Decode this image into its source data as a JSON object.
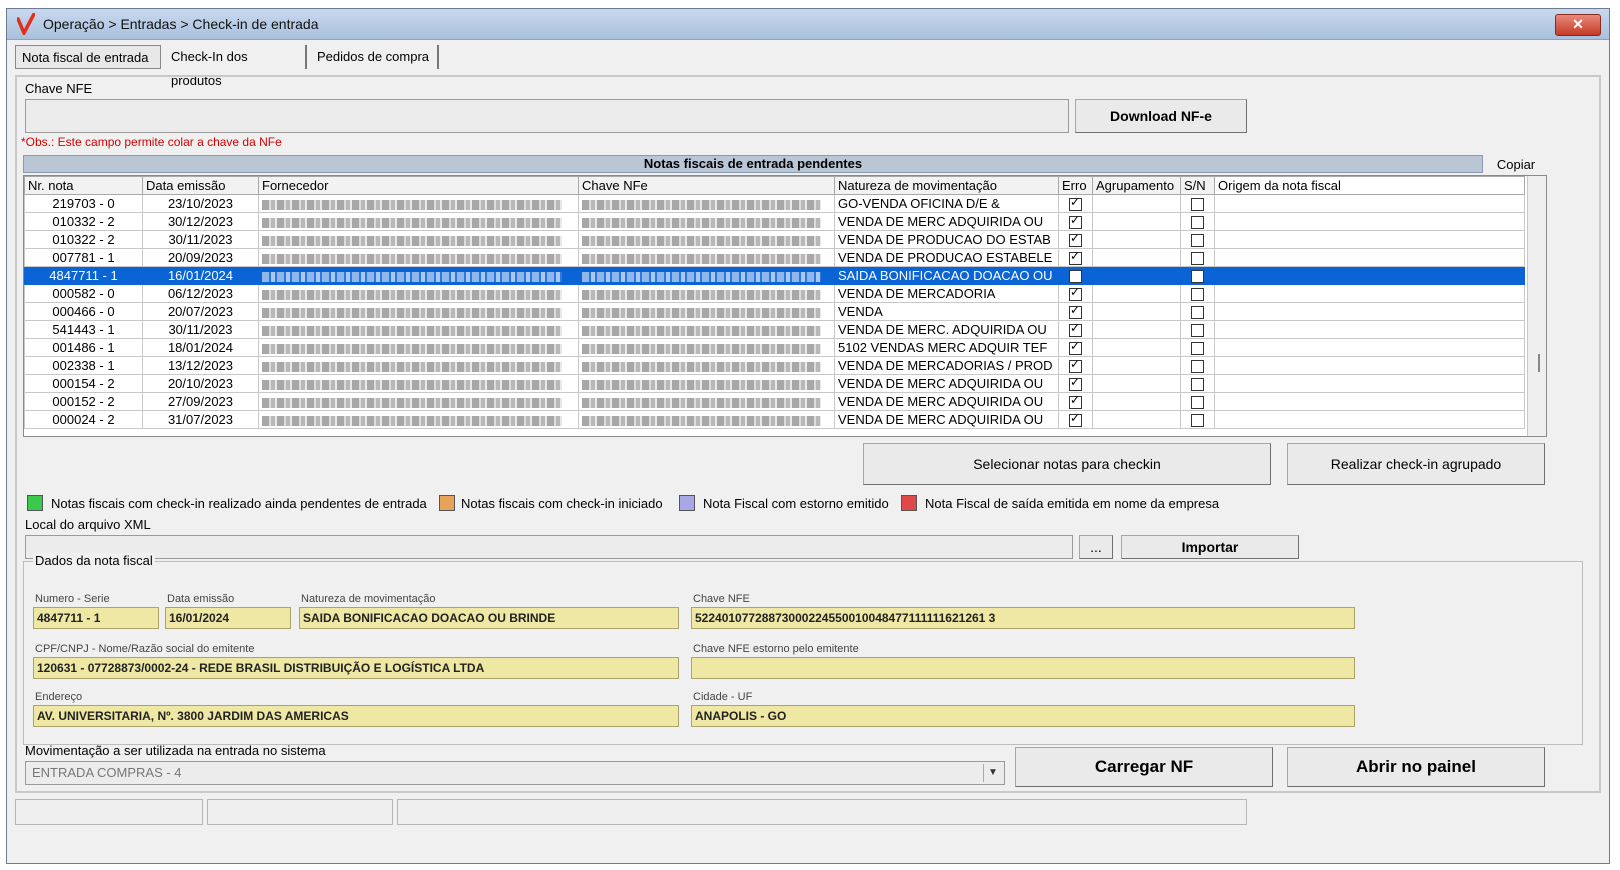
{
  "window": {
    "title": "Operação > Entradas > Check-in de entrada",
    "close_label": "✕"
  },
  "tabs": [
    {
      "label": "Nota fiscal de entrada"
    },
    {
      "label": "Check-In dos produtos"
    },
    {
      "label": "Pedidos de compra"
    }
  ],
  "nfe_key": {
    "label": "Chave NFE",
    "value": "",
    "download_label": "Download NF-e",
    "note": "*Obs.: Este campo permite colar a chave da NFe"
  },
  "grid": {
    "title": "Notas fiscais de entrada pendentes",
    "copy_label": "Copiar",
    "columns": [
      "Nr. nota",
      "Data emissão",
      "Fornecedor",
      "Chave NFe",
      "Natureza de movimentação",
      "Erro",
      "Agrupamento",
      "S/N",
      "Origem da nota fiscal"
    ],
    "rows": [
      {
        "nr": "219703 - 0",
        "date": "23/10/2023",
        "nature": "GO-VENDA OFICINA D/E &",
        "erro": true,
        "sn": false,
        "selected": false
      },
      {
        "nr": "010332 - 2",
        "date": "30/12/2023",
        "nature": "VENDA DE MERC ADQUIRIDA OU",
        "erro": true,
        "sn": false,
        "selected": false
      },
      {
        "nr": "010322 - 2",
        "date": "30/11/2023",
        "nature": "VENDA DE PRODUCAO DO ESTAB",
        "erro": true,
        "sn": false,
        "selected": false
      },
      {
        "nr": "007781 - 1",
        "date": "20/09/2023",
        "nature": "VENDA DE PRODUCAO ESTABELE",
        "erro": true,
        "sn": false,
        "selected": false
      },
      {
        "nr": "4847711 - 1",
        "date": "16/01/2024",
        "nature": "SAIDA BONIFICACAO DOACAO OU",
        "erro": false,
        "sn": false,
        "selected": true
      },
      {
        "nr": "000582 - 0",
        "date": "06/12/2023",
        "nature": "VENDA DE MERCADORIA",
        "erro": true,
        "sn": false,
        "selected": false
      },
      {
        "nr": "000466 - 0",
        "date": "20/07/2023",
        "nature": "VENDA",
        "erro": true,
        "sn": false,
        "selected": false
      },
      {
        "nr": "541443 - 1",
        "date": "30/11/2023",
        "nature": "VENDA DE MERC. ADQUIRIDA OU",
        "erro": true,
        "sn": false,
        "selected": false
      },
      {
        "nr": "001486 - 1",
        "date": "18/01/2024",
        "nature": "5102  VENDAS MERC ADQUIR TEF",
        "erro": true,
        "sn": false,
        "selected": false
      },
      {
        "nr": "002338 - 1",
        "date": "13/12/2023",
        "nature": "VENDA DE MERCADORIAS / PROD",
        "erro": true,
        "sn": false,
        "selected": false
      },
      {
        "nr": "000154 - 2",
        "date": "20/10/2023",
        "nature": "VENDA DE MERC ADQUIRIDA OU",
        "erro": true,
        "sn": false,
        "selected": false
      },
      {
        "nr": "000152 - 2",
        "date": "27/09/2023",
        "nature": "VENDA DE MERC ADQUIRIDA OU",
        "erro": true,
        "sn": false,
        "selected": false
      },
      {
        "nr": "000024 - 2",
        "date": "31/07/2023",
        "nature": "VENDA DE MERC ADQUIRIDA OU",
        "erro": true,
        "sn": false,
        "selected": false
      }
    ]
  },
  "actions": {
    "select_label": "Selecionar notas para checkin",
    "group_label": "Realizar check-in agrupado"
  },
  "legend": [
    {
      "label": "Notas fiscais com check-in realizado ainda pendentes de entrada",
      "color": "#3cc84a"
    },
    {
      "label": "Notas fiscais com check-in iniciado",
      "color": "#e8a35a"
    },
    {
      "label": "Nota Fiscal com estorno emitido",
      "color": "#a8a8e6"
    },
    {
      "label": "Nota Fiscal de saída emitida em nome da empresa",
      "color": "#e04848"
    }
  ],
  "xml": {
    "label": "Local do arquivo XML",
    "value": "",
    "browse_label": "...",
    "import_label": "Importar"
  },
  "invoice": {
    "title": "Dados da nota fiscal",
    "numero_label": "Numero - Serie",
    "numero": "4847711 - 1",
    "data_label": "Data emissão",
    "data": "16/01/2024",
    "natureza_label": "Natureza de movimentação",
    "natureza": "SAIDA BONIFICACAO DOACAO OU BRINDE",
    "chave_label": "Chave NFE",
    "chave": "52240107728873000224550010048477111111621261 3",
    "cnpj_label": "CPF/CNPJ - Nome/Razão social do emitente",
    "cnpj": "120631  -  07728873/0002-24 - REDE BRASIL DISTRIBUIÇÃO E LOGÍSTICA LTDA",
    "estorno_label": "Chave NFE estorno pelo emitente",
    "estorno": "",
    "endereco_label": "Endereço",
    "endereco": "AV. UNIVERSITARIA, Nº. 3800 JARDIM DAS AMERICAS",
    "cidade_label": "Cidade - UF",
    "cidade": "ANAPOLIS - GO"
  },
  "movement": {
    "label": "Movimentação a ser utilizada na entrada no sistema",
    "value": "ENTRADA COMPRAS - 4",
    "load_label": "Carregar NF",
    "open_label": "Abrir no painel"
  },
  "colors": {
    "selection": "#0a64d6",
    "accent_red": "#d40000",
    "yellow_field": "#eee8a4"
  }
}
